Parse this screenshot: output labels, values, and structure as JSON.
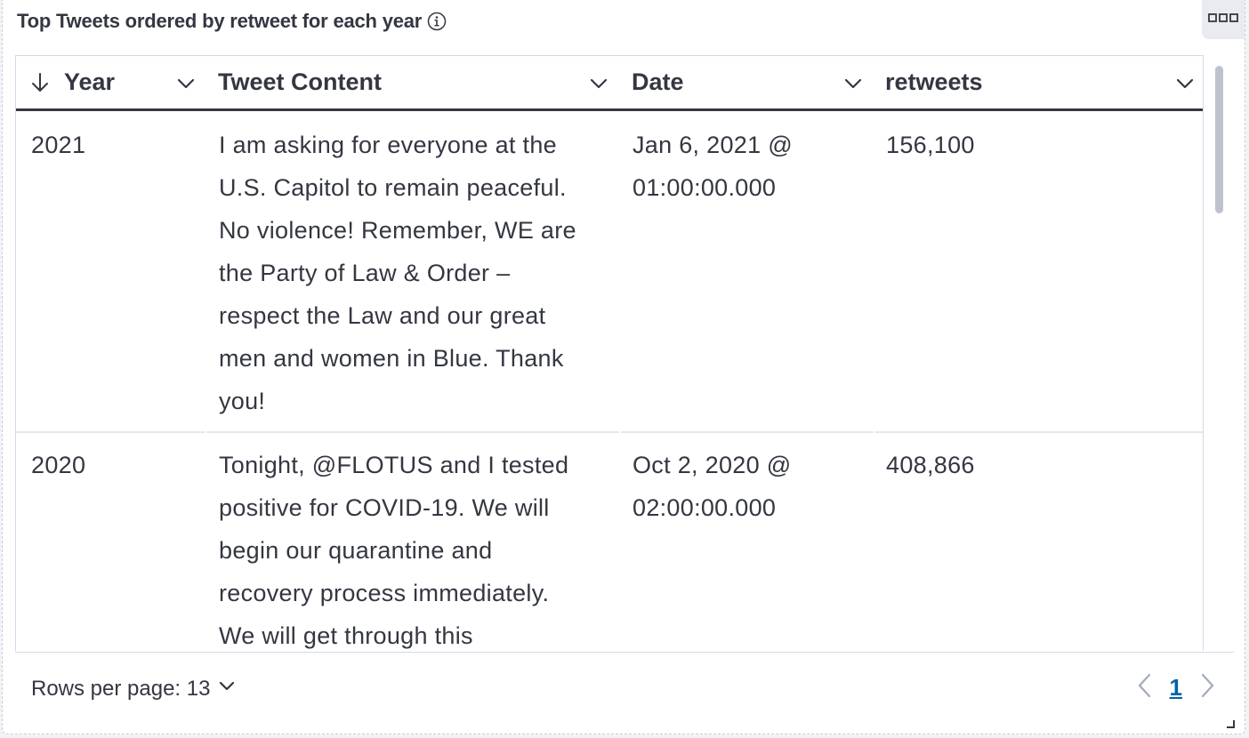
{
  "panel": {
    "title": "Top Tweets ordered by retweet for each year"
  },
  "table": {
    "columns": [
      {
        "label": "Year",
        "sort": "descending"
      },
      {
        "label": "Tweet Content"
      },
      {
        "label": "Date"
      },
      {
        "label": "retweets"
      }
    ],
    "rows": [
      {
        "year": "2021",
        "content_lines": [
          "I am asking for everyone at the",
          "U.S. Capitol to remain peaceful.",
          "No violence! Remember, WE are",
          "the Party of Law & Order –",
          "respect the Law and our great",
          "men and women in Blue. Thank",
          "you!"
        ],
        "date_lines": [
          "Jan 6, 2021 @",
          "01:00:00.000"
        ],
        "retweets": "156,100"
      },
      {
        "year": "2020",
        "content_lines": [
          "Tonight, @FLOTUS and I tested",
          "positive for COVID-19. We will",
          "begin our quarantine and",
          "recovery process immediately.",
          "We will get through this"
        ],
        "date_lines": [
          "Oct 2, 2020 @",
          "02:00:00.000"
        ],
        "retweets": "408,866"
      }
    ]
  },
  "footer": {
    "rows_per_page_label": "Rows per page: 13",
    "current_page": "1"
  },
  "icons": {
    "info": "info-icon",
    "menu": "options-menu-icon",
    "sort": "arrow-down-icon",
    "column_menu": "chevron-down-icon",
    "prev": "chevron-left-icon",
    "next": "chevron-right-icon",
    "resize": "resize-handle-icon"
  },
  "colors": {
    "link": "#0061a6",
    "text": "#343741",
    "border": "#d3dae6"
  }
}
